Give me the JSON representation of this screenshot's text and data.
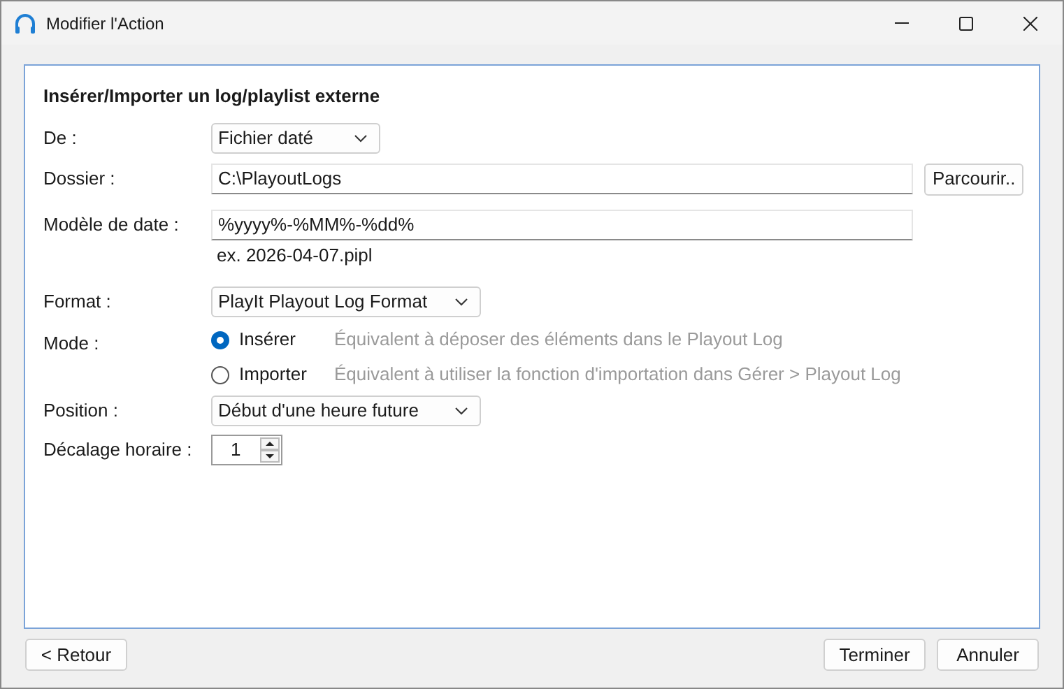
{
  "window": {
    "title": "Modifier l'Action"
  },
  "heading": "Insérer/Importer un log/playlist externe",
  "fields": [
    {
      "kind": "select",
      "label": "De :",
      "value": "Fichier daté"
    },
    {
      "kind": "input",
      "label": "Dossier :",
      "value": "C:\\PlayoutLogs",
      "button": "Parcourir.."
    },
    {
      "kind": "input",
      "label": "Modèle de date :",
      "value": "%yyyy%-%MM%-%dd%",
      "hint": "ex. 2026-04-07.pipl"
    },
    {
      "kind": "select",
      "label": "Format :",
      "value": "PlayIt Playout Log Format"
    },
    {
      "kind": "radio",
      "label": "Mode :",
      "options": [
        {
          "label": "Insérer",
          "description": "Équivalent à déposer des éléments dans le Playout Log",
          "selected": true
        },
        {
          "label": "Importer",
          "description": "Équivalent à utiliser la fonction d'importation dans Gérer > Playout Log",
          "selected": false
        }
      ]
    },
    {
      "kind": "select",
      "label": "Position :",
      "value": "Début d'une heure future"
    },
    {
      "kind": "spinner",
      "label": "Décalage horaire :",
      "value": "1"
    }
  ],
  "footer": {
    "back": "< Retour",
    "buttons": [
      "Terminer",
      "Annuler"
    ]
  }
}
